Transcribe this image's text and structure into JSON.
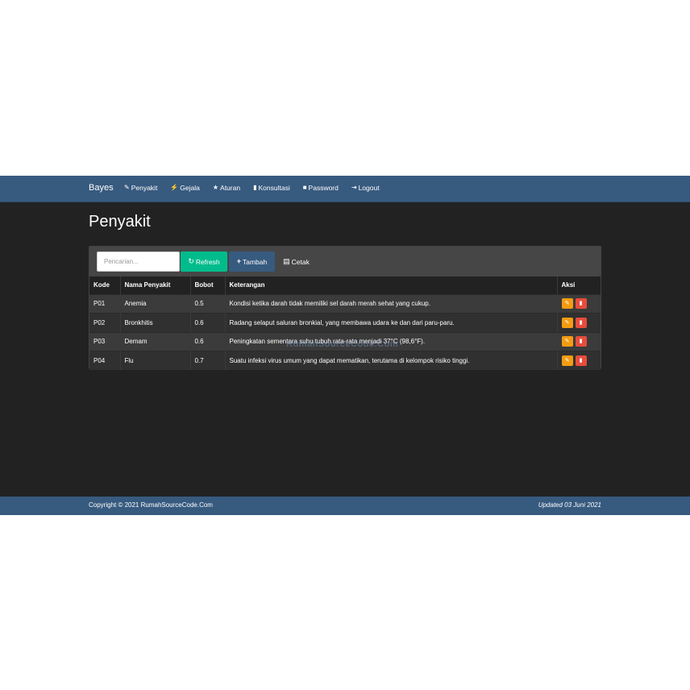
{
  "nav": {
    "brand": "Bayes",
    "items": [
      {
        "label": "Penyakit",
        "icon": "pin-icon"
      },
      {
        "label": "Gejala",
        "icon": "flash-icon"
      },
      {
        "label": "Aturan",
        "icon": "star-icon"
      },
      {
        "label": "Konsultasi",
        "icon": "stats-icon"
      },
      {
        "label": "Password",
        "icon": "lock-icon"
      },
      {
        "label": "Logout",
        "icon": "logout-icon"
      }
    ]
  },
  "page": {
    "title": "Penyakit"
  },
  "toolbar": {
    "search_placeholder": "Pencarian...",
    "refresh_label": "Refresh",
    "tambah_label": "Tambah",
    "cetak_label": "Cetak"
  },
  "table": {
    "headers": [
      "Kode",
      "Nama Penyakit",
      "Bobot",
      "Keterangan",
      "Aksi"
    ],
    "rows": [
      {
        "kode": "P01",
        "nama": "Anemia",
        "bobot": "0.5",
        "keterangan": "Kondisi ketika darah tidak memiliki sel darah merah sehat yang cukup."
      },
      {
        "kode": "P02",
        "nama": "Bronkhitis",
        "bobot": "0.6",
        "keterangan": "Radang selaput saluran bronkial, yang membawa udara ke dan dari paru-paru."
      },
      {
        "kode": "P03",
        "nama": "Demam",
        "bobot": "0.6",
        "keterangan": "Peningkatan sementara suhu tubuh rata-rata menjadi 37°C (98,6°F)."
      },
      {
        "kode": "P04",
        "nama": "Flu",
        "bobot": "0.7",
        "keterangan": "Suatu infeksi virus umum yang dapat mematikan, terutama di kelompok risiko tinggi."
      }
    ]
  },
  "watermark": "RumahSourceCode.Com",
  "footer": {
    "copyright": "Copyright © 2021 RumahSourceCode.Com",
    "updated": "Updated 03 Juni 2021"
  },
  "colors": {
    "navbar": "#375a7f",
    "background": "#222222",
    "refresh": "#00bc8c",
    "edit": "#f39c12",
    "delete": "#e74c3c"
  }
}
